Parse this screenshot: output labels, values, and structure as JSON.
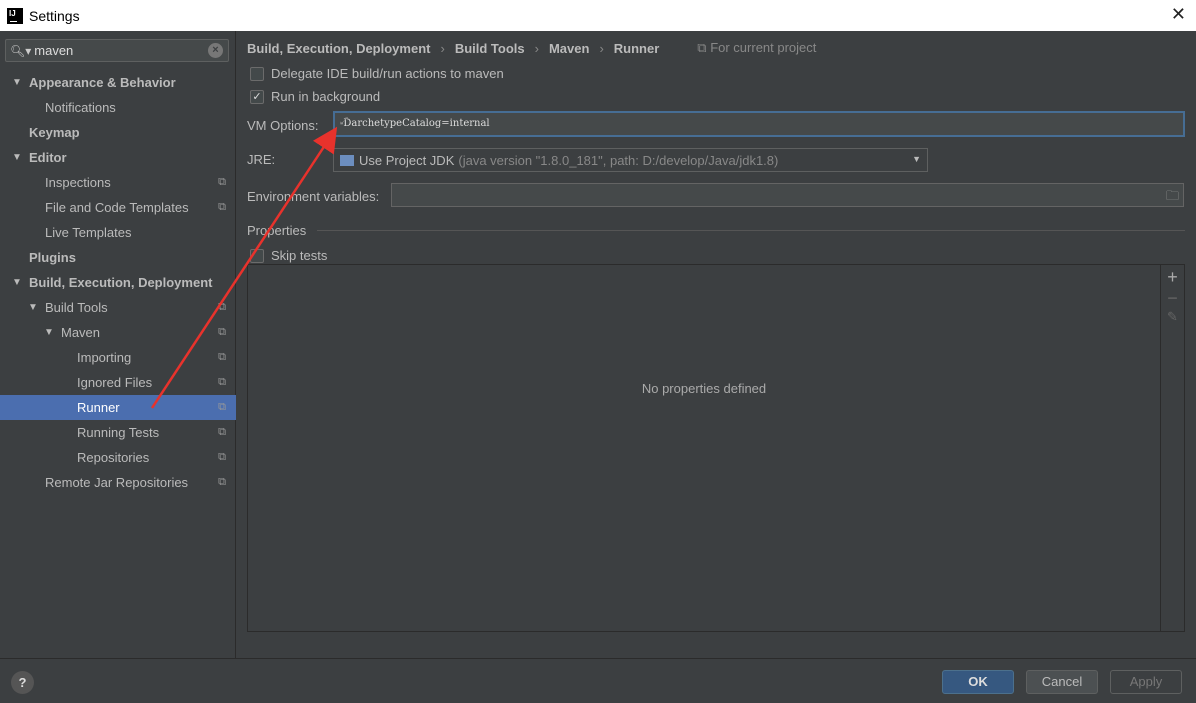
{
  "window": {
    "title": "Settings",
    "close": "✕"
  },
  "search": {
    "value": "maven"
  },
  "tree": [
    {
      "label": "Appearance & Behavior",
      "level": 0,
      "expanded": true,
      "bold": true
    },
    {
      "label": "Notifications",
      "level": 1
    },
    {
      "label": "Keymap",
      "level": 0,
      "bold": true
    },
    {
      "label": "Editor",
      "level": 0,
      "expanded": true,
      "bold": true
    },
    {
      "label": "Inspections",
      "level": 1,
      "copy": true
    },
    {
      "label": "File and Code Templates",
      "level": 1,
      "copy": true
    },
    {
      "label": "Live Templates",
      "level": 1
    },
    {
      "label": "Plugins",
      "level": 0,
      "bold": true
    },
    {
      "label": "Build, Execution, Deployment",
      "level": 0,
      "expanded": true,
      "bold": true
    },
    {
      "label": "Build Tools",
      "level": 1,
      "expanded": true,
      "copy": true
    },
    {
      "label": "Maven",
      "level": 2,
      "expanded": true,
      "copy": true
    },
    {
      "label": "Importing",
      "level": 3,
      "copy": true
    },
    {
      "label": "Ignored Files",
      "level": 3,
      "copy": true
    },
    {
      "label": "Runner",
      "level": 3,
      "copy": true,
      "selected": true
    },
    {
      "label": "Running Tests",
      "level": 3,
      "copy": true
    },
    {
      "label": "Repositories",
      "level": 3,
      "copy": true
    },
    {
      "label": "Remote Jar Repositories",
      "level": 1,
      "copy": true
    }
  ],
  "breadcrumb": [
    "Build, Execution, Deployment",
    "Build Tools",
    "Maven",
    "Runner"
  ],
  "for_project": "For current project",
  "delegate": {
    "label": "Delegate IDE build/run actions to maven",
    "checked": false
  },
  "background": {
    "label": "Run in background",
    "checked": true
  },
  "vm": {
    "label": "VM Options:",
    "value": "-DarchetypeCatalog=internal"
  },
  "jre": {
    "label": "JRE:",
    "value": "Use Project JDK",
    "detail": "(java version \"1.8.0_181\", path: D:/develop/Java/jdk1.8)"
  },
  "env": {
    "label": "Environment variables:",
    "value": ""
  },
  "properties": {
    "label": "Properties",
    "skip_tests": "Skip tests",
    "empty": "No properties defined"
  },
  "footer": {
    "help": "?",
    "ok": "OK",
    "cancel": "Cancel",
    "apply": "Apply"
  },
  "annotation_color": "#e8322c"
}
